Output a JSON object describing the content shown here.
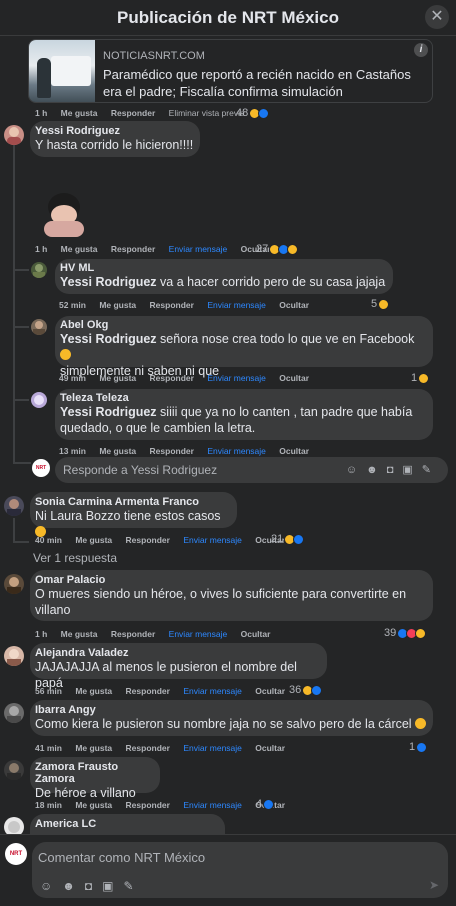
{
  "header": {
    "title": "Publicación de NRT México",
    "close_icon": "✕"
  },
  "link_preview": {
    "domain": "NOTICIASNRT.COM",
    "title": "Paramédico que reportó a recién nacido en Castaños era el padre; Fiscalía confirma simulación",
    "info_icon": "i"
  },
  "post_actions": {
    "time": "1 h",
    "like": "Me gusta",
    "reply": "Responder",
    "remove_preview": "Eliminar vista previa",
    "reaction_count": "48"
  },
  "comments": [
    {
      "name": "Yessi Rodriguez",
      "text": "Y hasta corrido le hicieron!!!!",
      "time": "1 h",
      "like": "Me gusta",
      "reply": "Responder",
      "message": "Enviar mensaje",
      "hide": "Ocultar",
      "reactions": "27",
      "replies": [
        {
          "name": "HV ML",
          "mention": "Yessi Rodriguez",
          "text": " va a hacer corrido pero de su casa jajaja",
          "time": "52 min",
          "like": "Me gusta",
          "reply": "Responder",
          "message": "Enviar mensaje",
          "hide": "Ocultar",
          "reactions": "5"
        },
        {
          "name": "Abel Okg",
          "mention": "Yessi Rodriguez",
          "text": " señora nose crea todo lo que ve en Facebook",
          "text2": "simplemente ni saben ni que",
          "time": "49 min",
          "like": "Me gusta",
          "reply": "Responder",
          "message": "Enviar mensaje",
          "hide": "Ocultar",
          "reactions": "1"
        },
        {
          "name": "Teleza Teleza",
          "mention": "Yessi Rodriguez",
          "text": " siiii que ya no lo canten , tan padre que había",
          "text2": "quedado, o que le cambien la letra.",
          "time": "13 min",
          "like": "Me gusta",
          "reply": "Responder",
          "message": "Enviar mensaje",
          "hide": "Ocultar",
          "reactions": ""
        }
      ],
      "reply_placeholder": "Responde a Yessi Rodriguez"
    },
    {
      "name": "Sonia Carmina Armenta Franco",
      "text": "Ni Laura Bozzo tiene estos casos",
      "time": "40 min",
      "like": "Me gusta",
      "reply": "Responder",
      "message": "Enviar mensaje",
      "hide": "Ocultar",
      "reactions": "21"
    },
    {
      "name": "Omar Palacio",
      "text": "O mueres siendo un héroe, o vives lo suficiente para convertirte en",
      "text2": "villano",
      "time": "1 h",
      "like": "Me gusta",
      "reply": "Responder",
      "message": "Enviar mensaje",
      "hide": "Ocultar",
      "reactions": "39"
    },
    {
      "name": "Alejandra Valadez",
      "text": "JAJAJAJJA al menos le pusieron el nombre del papá",
      "time": "56 min",
      "like": "Me gusta",
      "reply": "Responder",
      "message": "Enviar mensaje",
      "hide": "Ocultar",
      "reactions": "36"
    },
    {
      "name": "Ibarra Angy",
      "text": "Como kiera le pusieron su nombre jaja no se salvo pero de la cárcel",
      "time": "41 min",
      "like": "Me gusta",
      "reply": "Responder",
      "message": "Enviar mensaje",
      "hide": "Ocultar",
      "reactions": "1"
    },
    {
      "name": "Zamora Frausto Zamora",
      "text": "De héroe a villano",
      "time": "18 min",
      "like": "Me gusta",
      "reply": "Responder",
      "message": "Enviar mensaje",
      "hide": "Ocultar",
      "reactions": "4"
    },
    {
      "name": "America LC"
    }
  ],
  "see_replies": "Ver 1 respuesta",
  "composer": {
    "placeholder": "Comentar como NRT México",
    "icons": [
      "sticker-icon",
      "emoji-icon",
      "camera-icon",
      "gif-icon",
      "avatar-sticker-icon"
    ],
    "send_icon": "send-icon"
  },
  "colors": {
    "background": "#242526",
    "bubble": "#3a3b3c",
    "link_blue": "#2d88ff",
    "text": "#e4e6eb",
    "muted": "#b0b3b8"
  }
}
